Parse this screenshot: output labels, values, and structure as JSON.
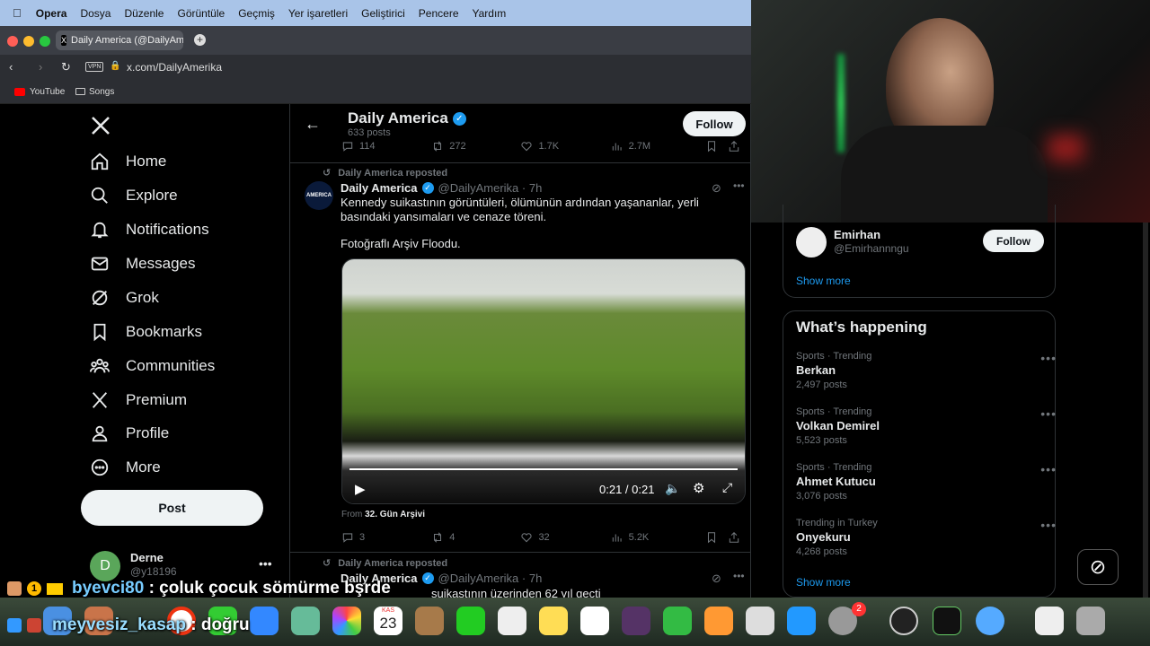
{
  "menubar": {
    "items": [
      "Opera",
      "Dosya",
      "Düzenle",
      "Görüntüle",
      "Geçmiş",
      "Yer işaretleri",
      "Geliştirici",
      "Pencere",
      "Yardım"
    ]
  },
  "browser": {
    "tab_title": "Daily America (@DailyAm",
    "url": "x.com/DailyAmerika",
    "vpn_label": "VPN",
    "bookmarks": [
      "YouTube",
      "Songs"
    ]
  },
  "nav": {
    "items": [
      "Home",
      "Explore",
      "Notifications",
      "Messages",
      "Grok",
      "Bookmarks",
      "Communities",
      "Premium",
      "Profile",
      "More"
    ],
    "post_label": "Post",
    "account_name": "Derne",
    "account_handle": "@y18196",
    "account_initial": "D"
  },
  "header": {
    "title": "Daily America",
    "posts": "633 posts",
    "follow": "Follow"
  },
  "top_actions": {
    "replies": "114",
    "reposts": "272",
    "likes": "1.7K",
    "views": "2.7M"
  },
  "tweet1": {
    "repost_label": "Daily America reposted",
    "name": "Daily America",
    "handle_time": "@DailyAmerika · 7h",
    "avatar_text": "AMERICA",
    "text1": "Kennedy suikastının görüntüleri, ölümünün ardından yaşananlar, yerli basındaki yansımaları ve cenaze töreni.",
    "text2": "Fotoğraflı Arşiv Floodu.",
    "video_time": "0:21 / 0:21",
    "video_progress": 1.0,
    "from_prefix": "From",
    "from_source": "32. Gün Arşivi",
    "replies": "3",
    "reposts": "4",
    "likes": "32",
    "views": "5.2K"
  },
  "tweet2": {
    "repost_label": "Daily America reposted",
    "name": "Daily America",
    "handle_time": "@DailyAmerika · 7h",
    "text": "suikastının üzerinden 62 yıl geçti"
  },
  "who_to_follow": {
    "name": "Emirhan",
    "handle": "@Emirhannngu",
    "follow": "Follow",
    "show_more": "Show more"
  },
  "whats_happening": {
    "title": "What’s happening",
    "trends": [
      {
        "category": "Sports · Trending",
        "name": "Berkan",
        "count": "2,497 posts"
      },
      {
        "category": "Sports · Trending",
        "name": "Volkan Demirel",
        "count": "5,523 posts"
      },
      {
        "category": "Sports · Trending",
        "name": "Ahmet Kutucu",
        "count": "3,076 posts"
      },
      {
        "category": "Trending in Turkey",
        "name": "Onyekuru",
        "count": "4,268 posts"
      }
    ],
    "show_more": "Show more"
  },
  "chat": {
    "line1_user": "byevci80",
    "line1_text": " : çoluk çocuk sömürme bşrde",
    "line2_user": "meyvesiz_kasap",
    "line2_text": " : doğru",
    "badge_number": "1"
  },
  "dock": {
    "calendar_month": "KAS",
    "calendar_day": "23",
    "notification_count": "2"
  },
  "colors": {
    "accent": "#1d9bf0",
    "background": "#000000",
    "text": "#e7e9ea",
    "muted": "#71767b"
  }
}
